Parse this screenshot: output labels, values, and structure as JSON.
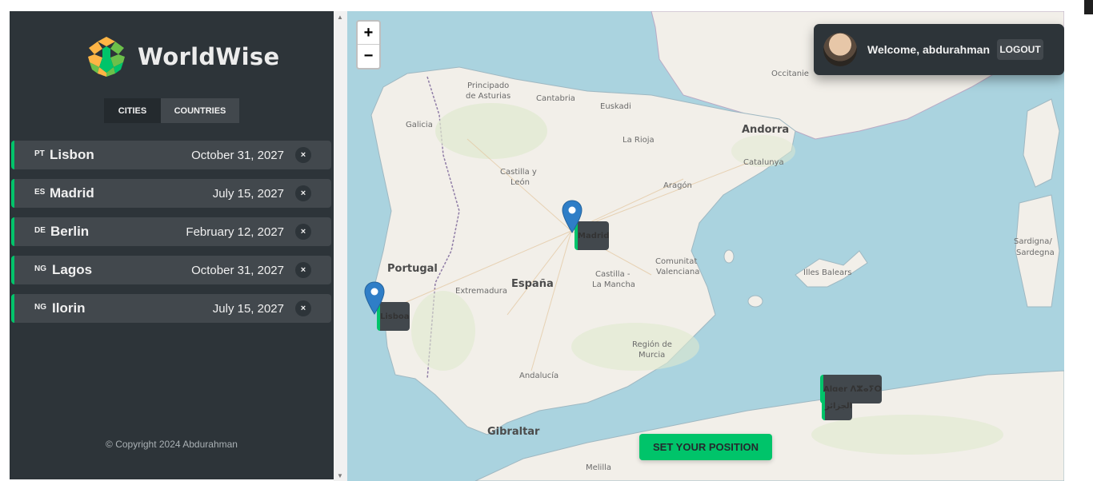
{
  "app": {
    "name": "WorldWise"
  },
  "tabs": [
    {
      "label": "CITIES",
      "active": true
    },
    {
      "label": "COUNTRIES",
      "active": false
    }
  ],
  "cities": [
    {
      "code": "PT",
      "name": "Lisbon",
      "date": "October 31, 2027",
      "delete": "×"
    },
    {
      "code": "ES",
      "name": "Madrid",
      "date": "July 15, 2027",
      "delete": "×"
    },
    {
      "code": "DE",
      "name": "Berlin",
      "date": "February 12, 2027",
      "delete": "×"
    },
    {
      "code": "NG",
      "name": "Lagos",
      "date": "October 31, 2027",
      "delete": "×"
    },
    {
      "code": "NG",
      "name": "Ilorin",
      "date": "July 15, 2027",
      "delete": "×"
    }
  ],
  "footer": {
    "copyright": "© Copyright 2024 Abdurahman"
  },
  "map": {
    "zoom_in": "+",
    "zoom_out": "−",
    "labels": {
      "principado": "Principado",
      "asturias": "de Asturias",
      "cantabria": "Cantabria",
      "euskadi": "Euskadi",
      "galicia": "Galicia",
      "larioja": "La Rioja",
      "occitanie": "Occitanie",
      "andorra": "Andorra",
      "catalunya": "Catalunya",
      "castilla": "Castilla y",
      "leon": "León",
      "aragon": "Aragón",
      "madrid": "Madrid",
      "portugal": "Portugal",
      "espana": "España",
      "castilla2": "Castilla -",
      "lamancha": "La Mancha",
      "comunitat": "Comunitat",
      "valenciana": "Valenciana",
      "extremadura": "Extremadura",
      "lisboa": "Lisboa",
      "illes": "Illes Balears",
      "sardegna": "Sardigna/",
      "sardegna2": "Sardegna",
      "region": "Región de",
      "murcia": "Murcia",
      "andalucia": "Andalucía",
      "alger": "Alger ⴷⵣⴰⵢⵔ",
      "aljazair": "الجزائر",
      "gibraltar": "Gibraltar",
      "melilla": "Melilla"
    },
    "marker_color": "#2f7ec7"
  },
  "user": {
    "welcome": "Welcome, abdurahman",
    "logout": "LOGOUT"
  },
  "actions": {
    "set_position": "SET YOUR POSITION"
  },
  "colors": {
    "accent": "#00c46a",
    "sidebar": "#2d3439",
    "item": "#42484d",
    "sea": "#aad3df",
    "land": "#f2efe9"
  }
}
